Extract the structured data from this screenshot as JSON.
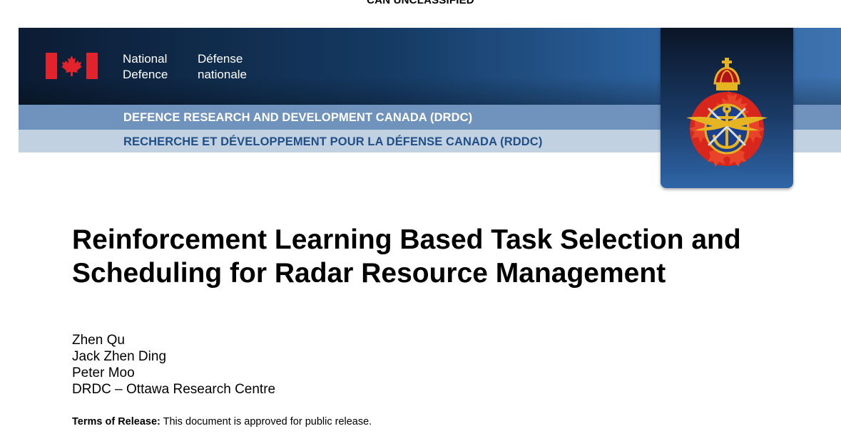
{
  "classification": "CAN UNCLASSIFIED",
  "header": {
    "department_en_line1": "National",
    "department_en_line2": "Defence",
    "department_fr_line1": "Défense",
    "department_fr_line2": "nationale",
    "org_en": "DEFENCE RESEARCH AND DEVELOPMENT CANADA (DRDC)",
    "org_fr": "RECHERCHE ET DÉVELOPPEMENT POUR LA DÉFENSE CANADA (RDDC)",
    "colors": {
      "banner_dark": "#0b1c33",
      "stripe_mid": "#6f93bd",
      "stripe_light": "#c2d1e1",
      "flag_red": "#e3232b"
    }
  },
  "icons": {
    "flag": "canada-flag-icon",
    "crest": "canadian-forces-crest-icon"
  },
  "document": {
    "title_line1": "Reinforcement Learning Based Task Selection and",
    "title_line2": "Scheduling for Radar Resource Management",
    "authors": [
      "Zhen Qu",
      "Jack Zhen Ding",
      "Peter Moo"
    ],
    "affiliation": "DRDC – Ottawa Research Centre",
    "terms_label": "Terms of Release:",
    "terms_text": "This document is approved for public release."
  }
}
